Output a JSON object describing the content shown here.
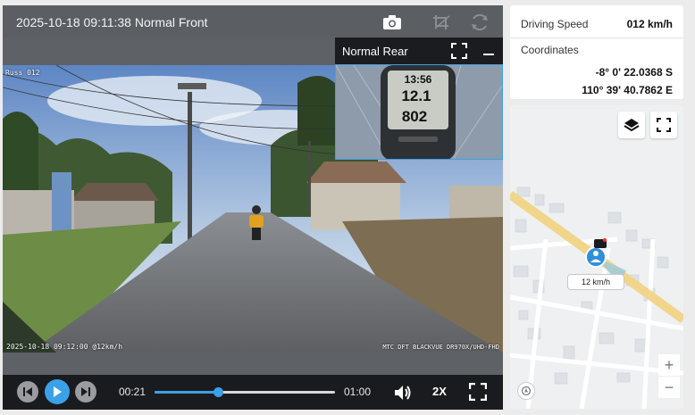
{
  "player": {
    "title": "2025-10-18 09:11:38 Normal Front",
    "overlay_top_left": "Russ 012",
    "overlay_bottom_left": "2025-10-18 09:12:00 @12km/h",
    "overlay_bottom_right": "MTC DFT BLACKVUE DR970X/UHD-FHD",
    "icons": [
      "camera-icon",
      "crop-icon",
      "swap-icon"
    ]
  },
  "rear": {
    "title": "Normal Rear",
    "display_time": "13:56",
    "display_speed": "12.1",
    "display_elev": "802"
  },
  "controls": {
    "current_time": "00:21",
    "total_time": "01:00",
    "progress": 0.35,
    "playback_speed": "2X"
  },
  "info": {
    "speed_label": "Driving Speed",
    "speed_value": "012 km/h",
    "coordinates_label": "Coordinates",
    "latitude": "-8° 0' 22.0368 S",
    "longitude": "110° 39' 40.7862 E"
  },
  "map": {
    "speed_tag": "12 km/h",
    "zoom_in": "+",
    "zoom_out": "−"
  },
  "colors": {
    "accent": "#3aa1e8",
    "control_bar": "#1a1b1e",
    "topbar": "#5b5e63"
  }
}
